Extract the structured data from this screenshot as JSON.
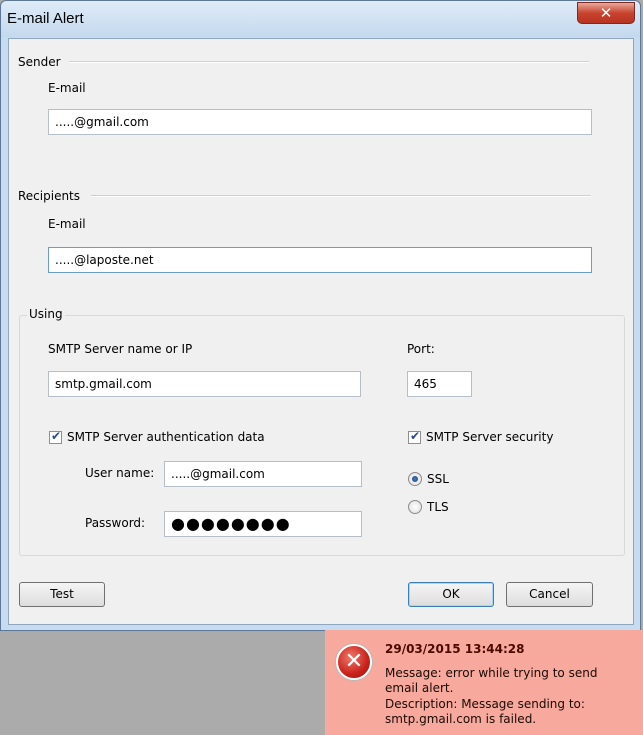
{
  "window": {
    "title": "E-mail Alert",
    "close_glyph": "✕"
  },
  "sender": {
    "group_label": "Sender",
    "email_label": "E-mail",
    "email_value": ".....@gmail.com"
  },
  "recipients": {
    "group_label": "Recipients",
    "email_label": "E-mail",
    "email_value": ".....@laposte.net"
  },
  "using": {
    "group_label": "Using",
    "smtp_server_label": "SMTP Server name or IP",
    "smtp_server_value": "smtp.gmail.com",
    "port_label": "Port:",
    "port_value": "465",
    "auth_checkbox_label": "SMTP Server authentication data",
    "auth_checked": true,
    "username_label": "User name:",
    "username_value": ".....@gmail.com",
    "password_label": "Password:",
    "password_value": "●●●●●●●●",
    "security_checkbox_label": "SMTP Server security",
    "security_checked": true,
    "ssl_label": "SSL",
    "tls_label": "TLS",
    "selected_security": "SSL"
  },
  "buttons": {
    "test": "Test",
    "ok": "OK",
    "cancel": "Cancel"
  },
  "notification": {
    "timestamp": "29/03/2015 13:44:28",
    "icon": "error-x-icon",
    "icon_glyph": "✕",
    "message_line1": "Message: error while trying to send",
    "message_line2": " email alert.",
    "description_line1": "Description: Message sending to:",
    "description_line2": " smtp.gmail.com is failed."
  },
  "colors": {
    "notification_bg": "#f8a99d",
    "window_frame": "#c7dcf0",
    "close_button": "#c8442f"
  }
}
